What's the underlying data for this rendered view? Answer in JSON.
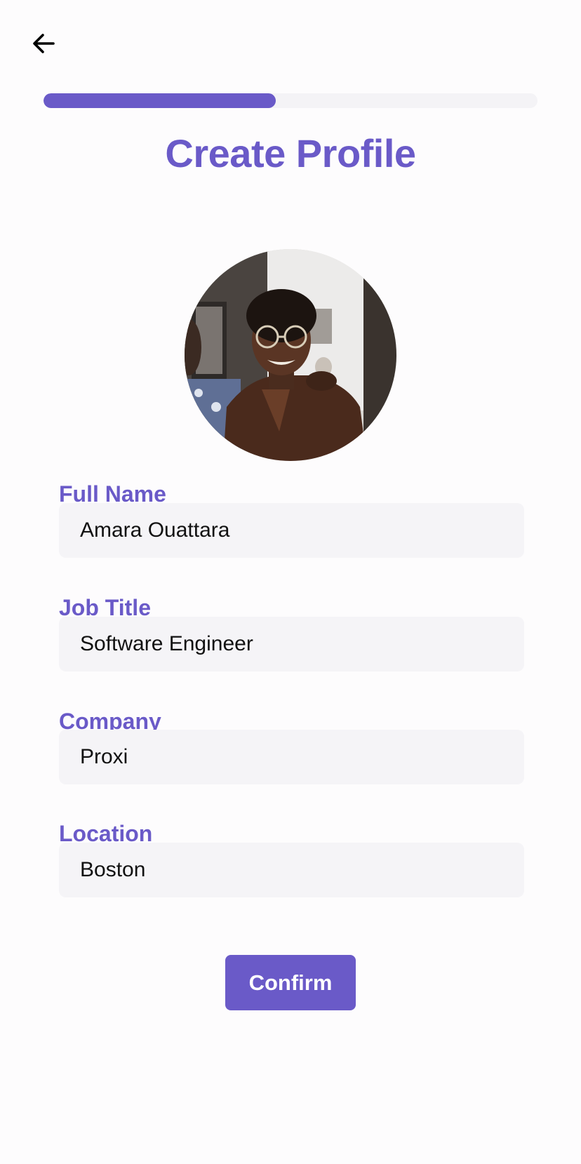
{
  "header": {
    "back_icon": "arrow-left-icon",
    "progress_fraction": 0.47,
    "title": "Create Profile"
  },
  "profile_photo": {
    "icon": "avatar-photo"
  },
  "form": {
    "fields": [
      {
        "label": "Full Name",
        "value": "Amara Ouattara"
      },
      {
        "label": "Job Title",
        "value": "Software Engineer"
      },
      {
        "label": "Company",
        "value": "Proxi"
      },
      {
        "label": "Location",
        "value": "Boston"
      }
    ],
    "confirm_label": "Confirm"
  },
  "colors": {
    "accent": "#6a5ac8",
    "input_background": "#f5f4f7",
    "page_background": "#fdfcfd"
  }
}
